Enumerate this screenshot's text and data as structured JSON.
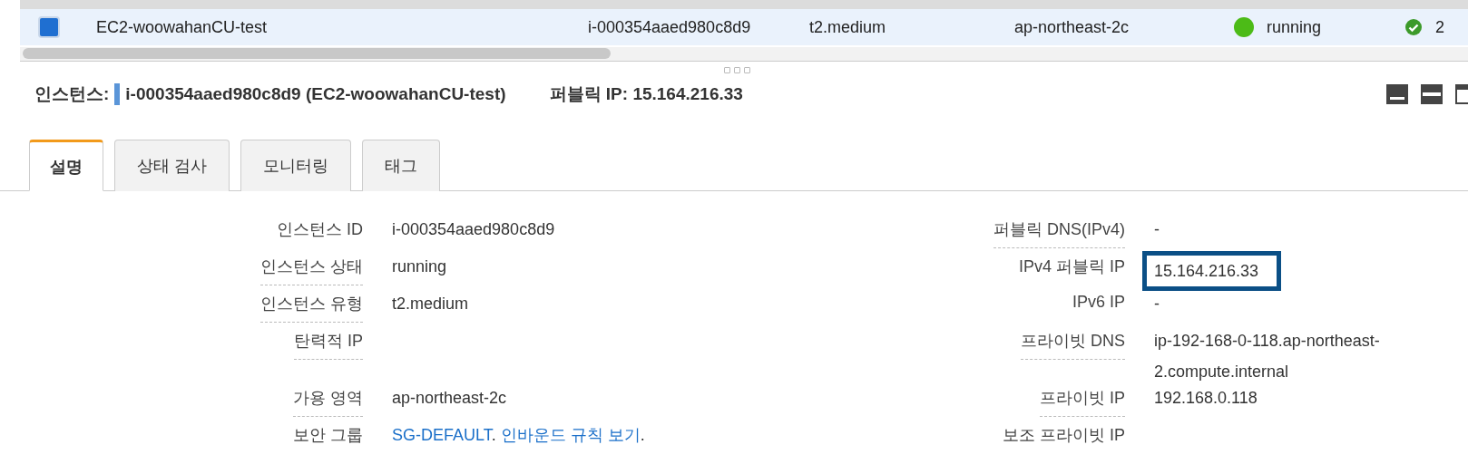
{
  "instances_table": {
    "rows": [
      {
        "selected": true,
        "cells": [
          {
            "kind": "checkbox"
          },
          {
            "kind": "text",
            "text": "EC2-woowahanCU-test"
          },
          {
            "kind": "text",
            "text": "i-000354aaed980c8d9"
          },
          {
            "kind": "text",
            "text": "t2.medium"
          },
          {
            "kind": "text",
            "text": "ap-northeast-2c"
          },
          {
            "kind": "status",
            "text": "running",
            "color": "#4cbb17"
          },
          {
            "kind": "check",
            "text": "2"
          }
        ]
      }
    ]
  },
  "detail_header": {
    "label": "인스턴스:",
    "instance": "i-000354aaed980c8d9 (EC2-woowahanCU-test)",
    "public_ip": "퍼블릭 IP: 15.164.216.33"
  },
  "tabs": [
    {
      "label": "설명",
      "selected": true
    },
    {
      "label": "상태 검사",
      "selected": false
    },
    {
      "label": "모니터링",
      "selected": false
    },
    {
      "label": "태그",
      "selected": false
    }
  ],
  "details": {
    "left": [
      {
        "label": "인스턴스 ID",
        "help": false,
        "value": "i-000354aaed980c8d9"
      },
      {
        "label": "인스턴스 상태",
        "help": true,
        "value": "running"
      },
      {
        "label": "인스턴스 유형",
        "help": true,
        "value": "t2.medium"
      },
      {
        "label": "탄력적 IP",
        "help": true
      },
      {
        "label": "가용 영역",
        "help": true,
        "value": "ap-northeast-2c"
      },
      {
        "label": "보안 그룹",
        "help": false,
        "parts": [
          {
            "kind": "link",
            "text": "SG-DEFAULT"
          },
          {
            "kind": "text",
            "text": ". "
          },
          {
            "kind": "link",
            "text": "인바운드 규칙 보기"
          },
          {
            "kind": "text",
            "text": "."
          }
        ]
      }
    ],
    "right": [
      {
        "label": "퍼블릭 DNS(IPv4)",
        "help": true,
        "value": "-"
      },
      {
        "label": "IPv4 퍼블릭 IP",
        "help": false,
        "value": "15.164.216.33",
        "highlighted": true
      },
      {
        "label": "IPv6 IP",
        "help": false,
        "value": "-"
      },
      {
        "label": "프라이빗 DNS",
        "help": true,
        "value": "ip-192-168-0-118.ap-northeast-2.compute.internal"
      },
      {
        "label": "프라이빗 IP",
        "help": true,
        "value": "192.168.0.118"
      },
      {
        "label": "보조 프라이빗 IP",
        "help": false
      }
    ]
  }
}
